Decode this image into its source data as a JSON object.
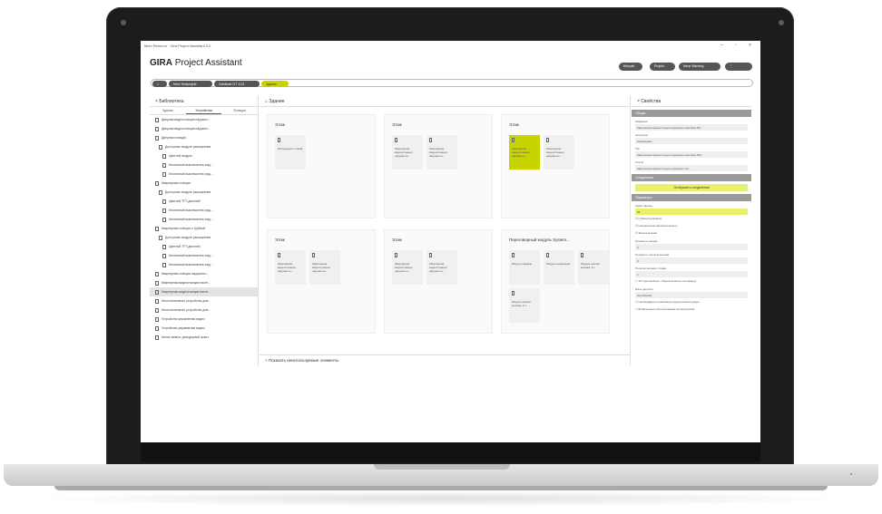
{
  "window": {
    "title": "Mein Reinrum · Gira Project Assistant 3.0",
    "controls": "–  ▫  ×"
  },
  "app": {
    "brand_bold": "GIRA",
    "brand_rest": "Project Assistant"
  },
  "toolbar": {
    "b1": "Beispiel",
    "b2": "Projekt",
    "b3": "Neue Wartung"
  },
  "breadcrumb": {
    "home": "⌂",
    "c1": "Mein Testprojekt",
    "c2": "Gebäude GT 1/13",
    "active": "Здание"
  },
  "library": {
    "title": "Библиотека",
    "tabs": [
      "Здание",
      "Устройства",
      "Функции"
    ],
    "items": [
      "Дверная видеостанция наружно...",
      "Дверная видеостанция наружно...",
      "Дверная станция",
      "Доступные модули расширения",
      "Цветной модуль",
      "Кнопочный выключатель вид...",
      "Кнопочный выключатель вид...",
      "Квартирная станция",
      "Доступные модули расширения",
      "Цветной TFT-дисплей",
      "Кнопочный выключатель вид...",
      "Кнопочный выключатель вид...",
      "Квартирная станция с трубкой",
      "Доступные модули расширения",
      "Цветной TFT-дисплей",
      "Кнопочный выключатель вид...",
      "Кнопочный выключатель вид...",
      "Квартирная станция наружного...",
      "Квартирная видеостанция насте...",
      "Квартирная видеостанция насте...",
      "Исполнительное устройство для...",
      "Исполнительное устройство для...",
      "Устройство управления видео",
      "Устройство управления видео",
      "Шлюз записи, декодерный шлюз"
    ]
  },
  "center": {
    "title": "Здание",
    "cards": [
      {
        "title": "Этаж",
        "items": [
          "Распределит. шкаф"
        ]
      },
      {
        "title": "Этаж",
        "items": [
          "Квартирная видеостанция наружного...",
          "Квартирная видеостанция наружного..."
        ]
      },
      {
        "title": "Этаж",
        "items": [
          "Квартирная видеостанция наружного...",
          "Квартирная видеостанция наружного..."
        ]
      },
      {
        "title": "Этаж",
        "items": [
          "Квартирная видеостанция наружного...",
          "Квартирная видеостанция наружного..."
        ]
      },
      {
        "title": "Этаж",
        "items": [
          "Квартирная видеостанция наружного...",
          "Квартирная видеостанция наружного..."
        ]
      },
      {
        "title": "Переговорный модуль System...",
        "items": [
          "Модуль камеры",
          "Модуль индикации",
          "Модуль кнопки вызова, 4-х",
          "Модуль кнопки вызова, 4-х..."
        ]
      }
    ],
    "footer": "Показать неиспользуемые элементы"
  },
  "properties": {
    "title": "Свойства",
    "s_general": "Общие",
    "name_label": "Название",
    "name_value": "Квартирная видеостанция наружного монтажа Plu...",
    "category_label": "Категория",
    "category_value": "Коммуникат",
    "type_label": "Тип",
    "type_value": "Квартирная видеостанция наружного монтажа Plus",
    "parent_label": "Слоты",
    "parent_value": "Квартирная видеостанция наружного мо...",
    "s_links": "Соединения",
    "links_btn": "Отобразить соединения",
    "s_params": "Параметры",
    "addr_label": "Адрес звонка",
    "addr_value": "48",
    "checks": [
      "Главный домофон",
      "Направление автоматического",
      "Звонок вызова"
    ],
    "vol_label": "Громкость звонка",
    "vol_value": "3",
    "vol2_label": "Громкость сигнала вызова",
    "vol2_value": "3",
    "calls_label": "Попытки вызова с этажа",
    "calls_value": "1",
    "check2": "TFT-дисплей вкл. (Переключатель на камеру)",
    "lang_label": "Язык дисплея",
    "lang_value": "Английский",
    "check3": "Необходимость активации переключения двери",
    "check4": "Выбрасывать использование кнопки вызова"
  },
  "laptop": {
    "base_label": "■ ◦"
  }
}
